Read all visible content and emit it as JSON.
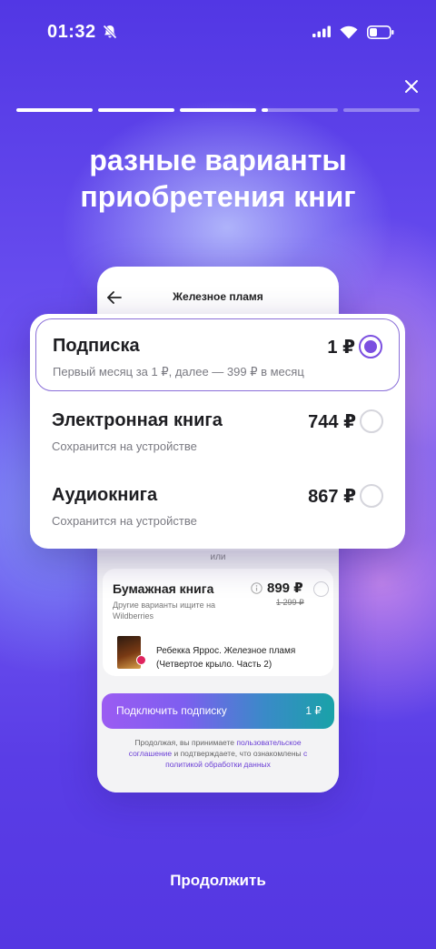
{
  "status_bar": {
    "time": "01:32",
    "icons": [
      "bell-muted-icon",
      "signal-icon",
      "wifi-icon",
      "battery-icon"
    ]
  },
  "story": {
    "segments_total": 5,
    "segment_progress": [
      1,
      1,
      1,
      0.08,
      0
    ],
    "headline_line1": "разные варианты",
    "headline_line2": "приобретения книг"
  },
  "phone": {
    "title": "Железное пламя",
    "options": [
      {
        "title": "Подписка",
        "price": "1 ₽",
        "subtitle": "Первый месяц за 1 ₽, далее — 399 ₽ в месяц",
        "selected": true
      },
      {
        "title": "Электронная книга",
        "price": "744 ₽",
        "subtitle": "Сохранится на устройстве",
        "selected": false
      },
      {
        "title": "Аудиокнига",
        "price": "867 ₽",
        "subtitle": "Сохранится на устройстве",
        "selected": false
      }
    ],
    "or_label": "или",
    "paper": {
      "title": "Бумажная книга",
      "price": "899 ₽",
      "old_price": "1 299 ₽",
      "subtitle": "Другие варианты ищите на Wildberries",
      "book_name": "Ребекка Яррос. Железное пламя (Четвертое крыло. Часть 2)"
    },
    "subscribe_button": {
      "label": "Подключить подписку",
      "price": "1 ₽"
    },
    "legal": {
      "text1": "Продолжая, вы принимаете ",
      "link1": "пользовательское соглашение",
      "text2": " и подтверждаете, что ознакомлены ",
      "link2": "с политикой обработки данных"
    }
  },
  "continue_label": "Продолжить",
  "colors": {
    "accent": "#7b4fe0",
    "background": "#5a3fe6"
  }
}
